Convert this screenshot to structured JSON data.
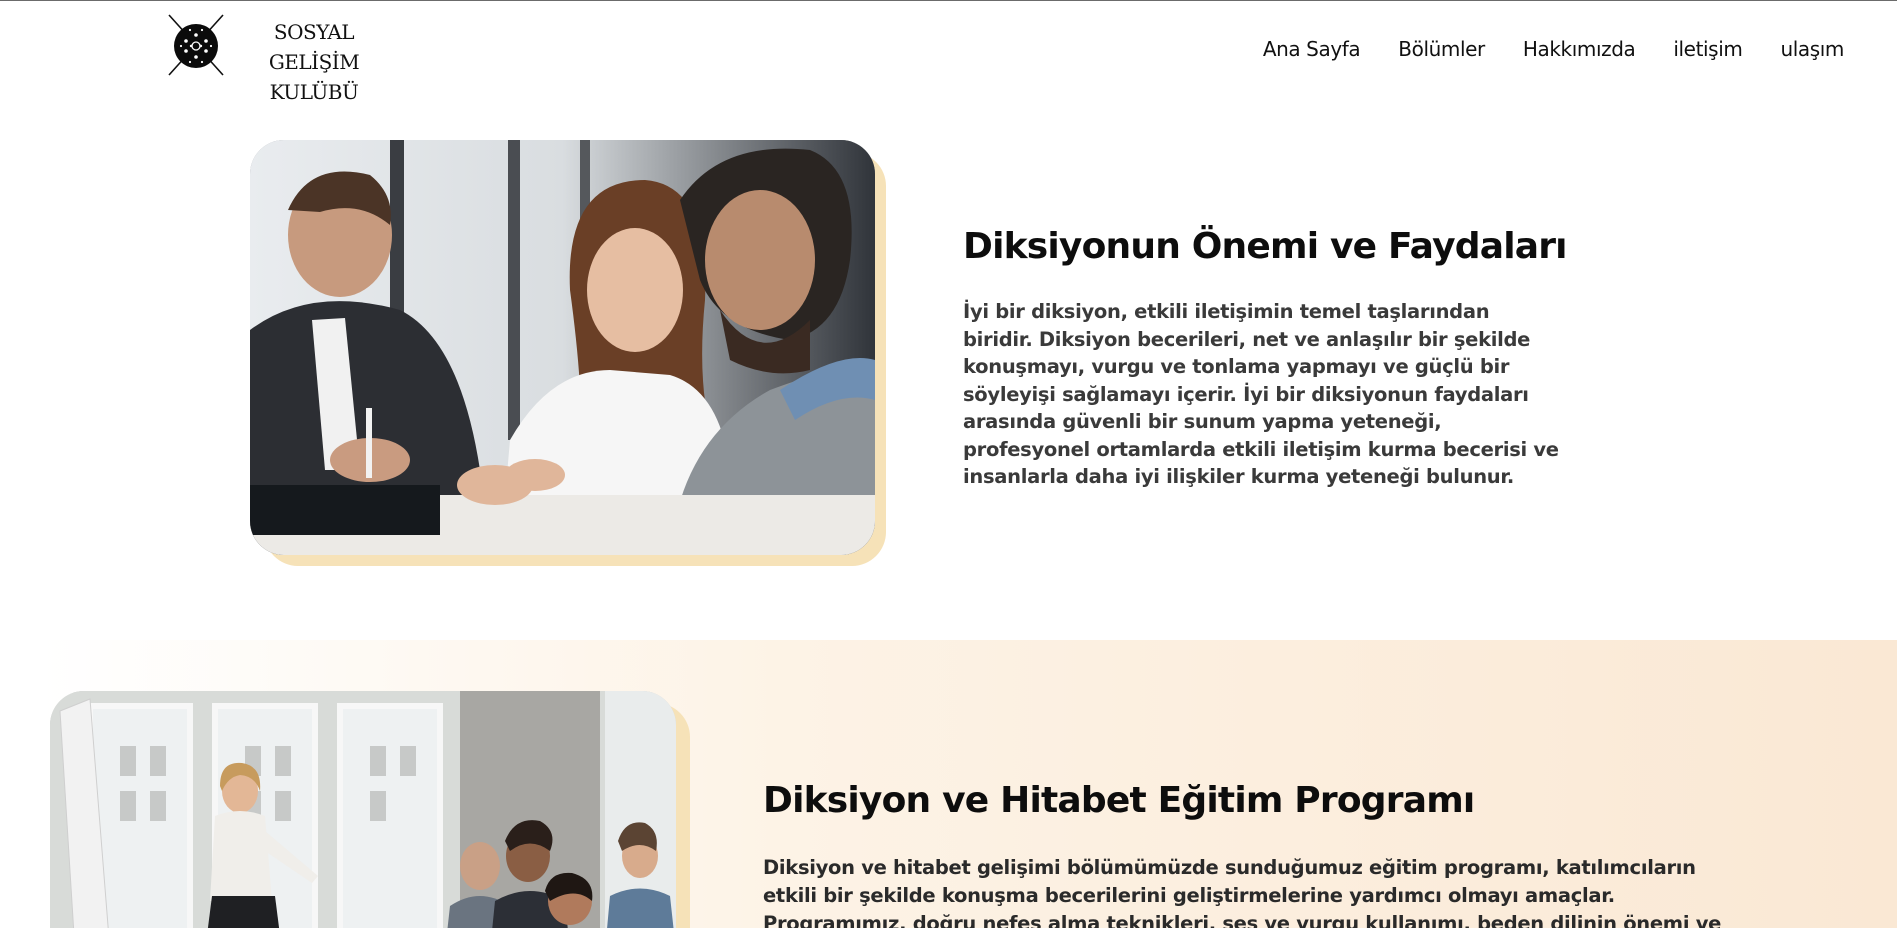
{
  "header": {
    "logo_line1": "SOSYAL GELİŞİM",
    "logo_line2": "KULÜBÜ",
    "nav": [
      {
        "label": "Ana Sayfa"
      },
      {
        "label": "Bölümler"
      },
      {
        "label": "Hakkımızda"
      },
      {
        "label": "iletişim"
      },
      {
        "label": "ulaşım"
      }
    ]
  },
  "section1": {
    "title": "Diksiyonun Önemi ve Faydaları",
    "text": "İyi bir diksiyon, etkili iletişimin temel taşlarından biridir. Diksiyon becerileri, net ve anlaşılır bir şekilde konuşmayı, vurgu ve tonlama yapmayı ve güçlü bir söyleyişi sağlamayı içerir. İyi bir diksiyonun faydaları arasında güvenli bir sunum yapma yeteneği, profesyonel ortamlarda etkili iletişim kurma becerisi ve insanlarla daha iyi ilişkiler kurma yeteneği bulunur."
  },
  "section2": {
    "title": "Diksiyon ve Hitabet Eğitim Programı",
    "text": "Diksiyon ve hitabet gelişimi bölümümüzde sunduğumuz eğitim programı, katılımcıların etkili bir şekilde konuşma becerilerini geliştirmelerine yardımcı olmayı amaçlar. Programımız, doğru nefes alma teknikleri, ses ve vurgu kullanımı, beden dilinin önemi ve"
  },
  "colors": {
    "accent_frame": "#f6e2b8",
    "section2_bg_end": "#fae8d4",
    "text_dark": "#0d0d0d"
  }
}
